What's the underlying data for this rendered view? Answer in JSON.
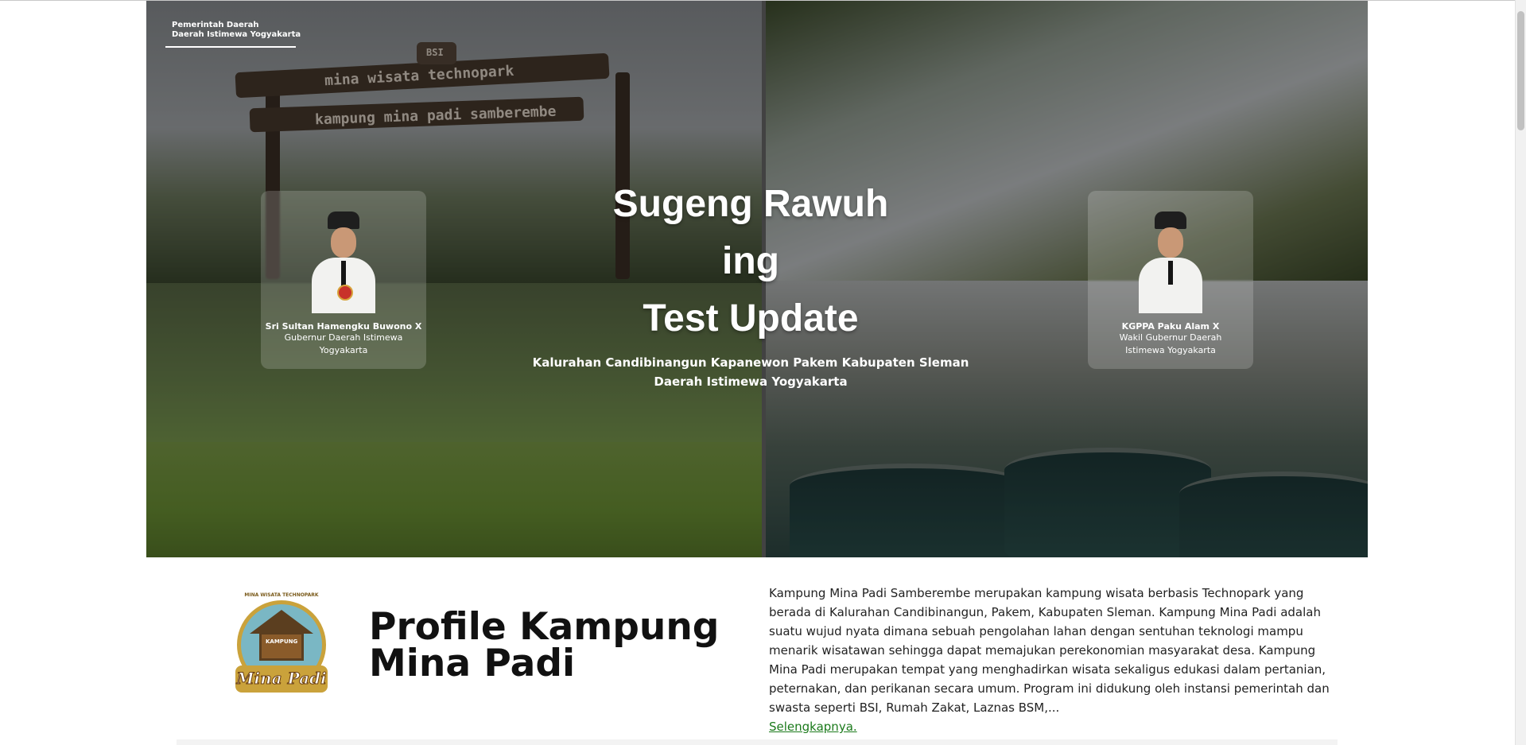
{
  "header": {
    "gov_line1": "Pemerintah Daerah",
    "gov_line2": "Daerah Istimewa Yogyakarta"
  },
  "hero": {
    "title_line1": "Sugeng Rawuh",
    "title_line2": "ing",
    "title_line3": "Test Update",
    "subtitle_line1": "Kalurahan Candibinangun Kapanewon Pakem Kabupaten Sleman",
    "subtitle_line2": "Daerah Istimewa Yogyakarta",
    "sign_line1": "mina wisata technopark",
    "sign_line2": "kampung mina padi samberembe",
    "sign_badge": "BSI"
  },
  "leaders": [
    {
      "name": "Sri Sultan Hamengku Buwono X",
      "role": "Gubernur Daerah Istimewa Yogyakarta"
    },
    {
      "name": "KGPPA Paku Alam X",
      "role": "Wakil Gubernur Daerah Istimewa Yogyakarta"
    }
  ],
  "profile": {
    "title_line1": "Profile Kampung",
    "title_line2": "Mina Padi",
    "logo_top": "MINA WISATA TECHNOPARK",
    "logo_tag": "KAMPUNG",
    "logo_word": "Mina Padi",
    "description": "Kampung Mina Padi Samberembe merupakan kampung wisata berbasis Technopark yang berada di Kalurahan Candibinangun, Pakem, Kabupaten Sleman. Kampung Mina Padi adalah suatu wujud nyata dimana sebuah pengolahan lahan dengan sentuhan teknologi mampu menarik wisatawan sehingga dapat memajukan perekonomian masyarakat desa. Kampung Mina Padi merupakan tempat yang menghadirkan wisata sekaligus edukasi dalam pertanian, peternakan, dan perikanan secara umum. Program ini didukung oleh instansi pemerintah dan swasta seperti BSI, Rumah Zakat, Laznas BSM,...",
    "read_more": "Selengkapnya."
  }
}
